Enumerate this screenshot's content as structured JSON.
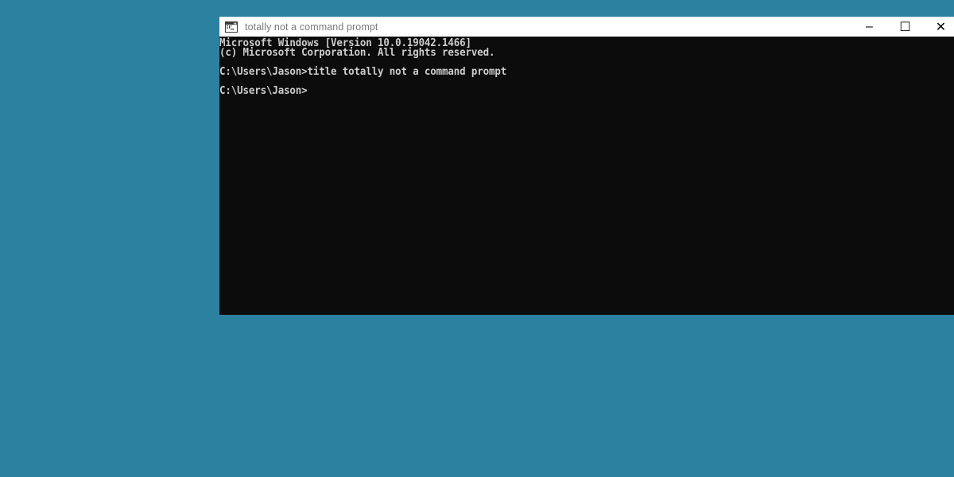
{
  "desktop": {
    "background_color": "#2b819f"
  },
  "window": {
    "title": "totally not a command prompt",
    "icon": "cmd-prompt-icon",
    "title_bar_color": "#ffffff",
    "title_text_color": "#7a7a7a",
    "console_background_color": "#0c0c0c",
    "console_text_color": "#cccccc",
    "controls": {
      "minimize_label": "–",
      "maximize_label": "☐",
      "close_label": "✕"
    }
  },
  "console": {
    "lines": [
      "Microsoft Windows [Version 10.0.19042.1466]",
      "(c) Microsoft Corporation. All rights reserved.",
      "",
      "C:\\Users\\Jason>title totally not a command prompt",
      "",
      "C:\\Users\\Jason>"
    ]
  }
}
